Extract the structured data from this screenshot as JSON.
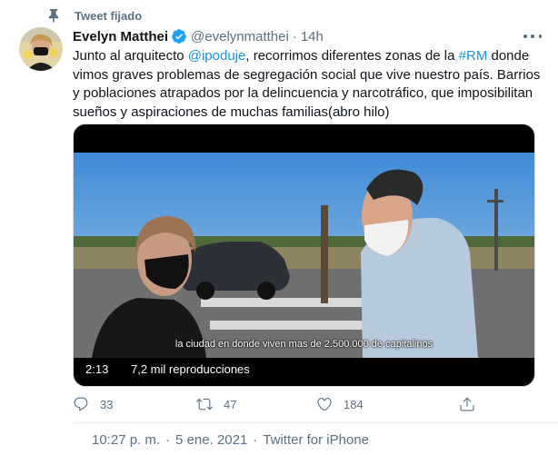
{
  "pinned": {
    "label": "Tweet fijado",
    "icon": "pin-icon"
  },
  "author": {
    "name": "Evelyn Matthei",
    "handle": "@evelynmatthei",
    "separator": "·",
    "time": "14h",
    "verified_icon": "verified-badge-icon",
    "accent": "#1da1f2"
  },
  "tweet": {
    "parts": [
      {
        "text": "Junto al arquitecto ",
        "kind": "text"
      },
      {
        "text": "@ipoduje",
        "kind": "link"
      },
      {
        "text": ", recorrimos diferentes zonas de la ",
        "kind": "text"
      },
      {
        "text": "#RM",
        "kind": "link"
      },
      {
        "text": " donde vimos graves problemas de segregación social que vive nuestro país. Barrios y poblaciones atrapados por la delincuencia y narcotráfico, que imposibilitan sueños y aspiraciones de muchas familias(abro hilo)",
        "kind": "text"
      }
    ],
    "link_color": "#1b95e0"
  },
  "video": {
    "caption": "la ciudad en donde viven mas de 2.500.000 de capitalinos",
    "duration": "2:13",
    "views": "7,2 mil reproducciones"
  },
  "actions": {
    "reply_count": "33",
    "retweet_count": "47",
    "like_count": "184",
    "icons": [
      "reply-icon",
      "retweet-icon",
      "like-icon",
      "share-icon"
    ]
  },
  "footer": {
    "time": "10:27 p. m.",
    "separator": "·",
    "date": "5 ene. 2021",
    "source": "Twitter for iPhone"
  },
  "colors": {
    "secondary_text": "#5b7083",
    "primary_text": "#0f1419"
  }
}
